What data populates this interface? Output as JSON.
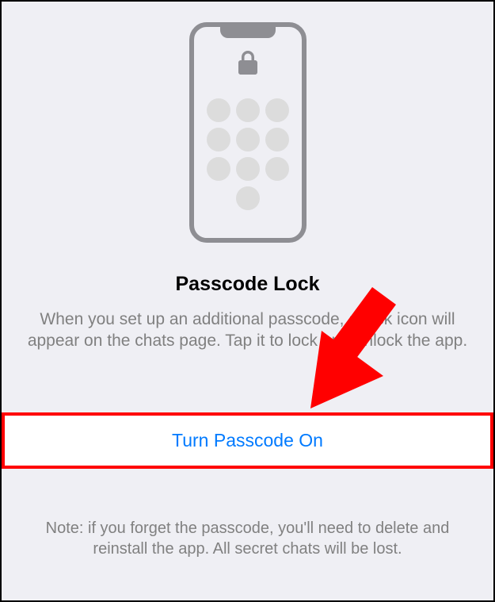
{
  "illustration": {
    "icon": "lock-icon"
  },
  "title": "Passcode Lock",
  "description": "When you set up an additional passcode, a lock icon will appear on the chats page. Tap it to lock and unlock the app.",
  "button": {
    "label": "Turn Passcode On"
  },
  "note": "Note: if you forget the passcode, you'll need to delete and reinstall the app. All secret chats will be lost.",
  "colors": {
    "accent": "#007AFF",
    "highlight": "#FF0000",
    "grey": "#8E8E93",
    "background": "#EFEFF4"
  }
}
